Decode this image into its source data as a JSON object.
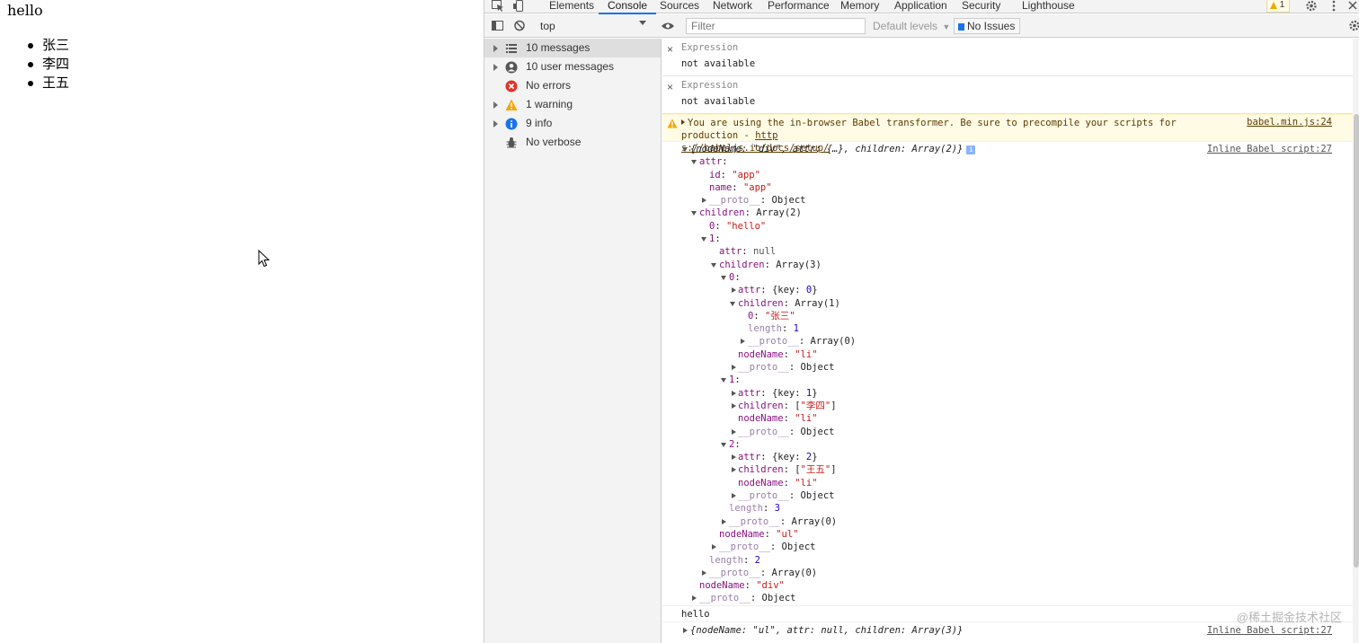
{
  "page": {
    "heading": "hello",
    "list": [
      "张三",
      "李四",
      "王五"
    ]
  },
  "devtools": {
    "tabs": [
      "Elements",
      "Console",
      "Sources",
      "Network",
      "Performance",
      "Memory",
      "Application",
      "Security",
      "Lighthouse"
    ],
    "active_tab": "Console",
    "warning_count": "1",
    "context": "top",
    "filter_placeholder": "Filter",
    "levels": "Default levels",
    "issues": "No Issues",
    "sidebar": [
      {
        "label": "10 messages",
        "icon": "list-icon",
        "expandable": true,
        "selected": true
      },
      {
        "label": "10 user messages",
        "icon": "user-icon",
        "expandable": true,
        "selected": false
      },
      {
        "label": "No errors",
        "icon": "error-icon",
        "expandable": false,
        "selected": false
      },
      {
        "label": "1 warning",
        "icon": "warning-icon",
        "expandable": true,
        "selected": false
      },
      {
        "label": "9 info",
        "icon": "info-icon",
        "expandable": true,
        "selected": false
      },
      {
        "label": "No verbose",
        "icon": "bug-icon",
        "expandable": false,
        "selected": false
      }
    ],
    "expressions": [
      {
        "label": "Expression",
        "value": "not available"
      },
      {
        "label": "Expression",
        "value": "not available"
      }
    ],
    "warning": {
      "text": "You are using the in-browser Babel transformer. Be sure to precompile your scripts for production - ",
      "link_a": "http",
      "link_b": "s://babeljs.io/docs/setup/",
      "source": "babel.min.js:24"
    },
    "object_source": "Inline Babel script:27",
    "object_summary": "{nodeName: \"div\", attr: {…}, children: Array(2)}",
    "log_hello": "hello",
    "last_summary": "{nodeName: \"ul\", attr: null, children: Array(3)}",
    "last_source": "Inline Babel script:27",
    "watermark": "@稀土掘金技术社区"
  },
  "colors": {
    "accent": "#1a73e8",
    "warning_bg": "#fffbe5",
    "string": "#c41a16",
    "number": "#1c00cf",
    "key": "#881280"
  }
}
